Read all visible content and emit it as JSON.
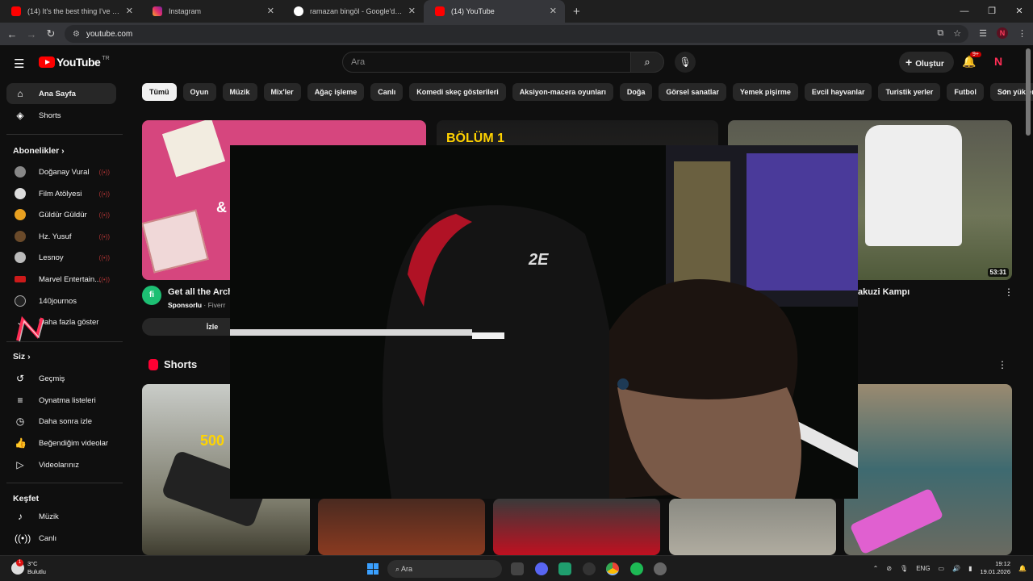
{
  "browser": {
    "tabs": [
      {
        "label": "(14) It's the best thing I've seen",
        "favicon_color": "#ff0000",
        "active": false
      },
      {
        "label": "Instagram",
        "favicon_color": "#e1306c",
        "active": false
      },
      {
        "label": "ramazan bingöl - Google'da Ara",
        "favicon_color": "#ffffff",
        "active": false
      },
      {
        "label": "(14) YouTube",
        "favicon_color": "#ff0000",
        "active": true
      }
    ],
    "url": "youtube.com"
  },
  "header": {
    "logo_text": "YouTube",
    "country_code": "TR",
    "search_placeholder": "Ara",
    "create_label": "Oluştur",
    "notif_badge": "9+"
  },
  "sidebar": {
    "main": [
      {
        "label": "Ana Sayfa",
        "icon": "home-icon"
      },
      {
        "label": "Shorts",
        "icon": "shorts-icon"
      }
    ],
    "subs_heading": "Abonelikler",
    "subscriptions": [
      {
        "label": "Doğanay Vural",
        "color": "#888888"
      },
      {
        "label": "Film Atölyesi",
        "color": "#dddddd"
      },
      {
        "label": "Güldür Güldür",
        "color": "#e8a020"
      },
      {
        "label": "Hz. Yusuf",
        "color": "#6a4a2a"
      },
      {
        "label": "Lesnoy",
        "color": "#bbbbbb"
      },
      {
        "label": "Marvel Entertain...",
        "color": "#cc1a1a"
      },
      {
        "label": "140journos",
        "color": "#222222"
      }
    ],
    "show_more": "Daha fazla göster",
    "you_heading": "Siz",
    "you_items": [
      {
        "label": "Geçmiş",
        "icon": "history-icon"
      },
      {
        "label": "Oynatma listeleri",
        "icon": "playlist-icon"
      },
      {
        "label": "Daha sonra izle",
        "icon": "clock-icon"
      },
      {
        "label": "Beğendiğim videolar",
        "icon": "thumbs-up-icon"
      },
      {
        "label": "Videolarınız",
        "icon": "video-icon"
      }
    ],
    "explore_heading": "Keşfet",
    "explore_items": [
      {
        "label": "Müzik",
        "icon": "music-icon"
      },
      {
        "label": "Canlı",
        "icon": "live-icon"
      }
    ]
  },
  "chips": [
    "Tümü",
    "Oyun",
    "Müzik",
    "Mix'ler",
    "Ağaç işleme",
    "Canlı",
    "Komedi skeç gösterileri",
    "Aksiyon-macera oyunları",
    "Doğa",
    "Görsel sanatlar",
    "Yemek pişirme",
    "Evcil hayvanlar",
    "Turistik yerler",
    "Futbol",
    "Son yüklenen"
  ],
  "videos": {
    "ad_title": "Get all the Archi",
    "ad_sponsor": "Sponsorlu",
    "ad_channel": "Fiverr",
    "ad_button": "İzle",
    "ad_thumb_text": "&",
    "mid_thumb_text": "BÖLÜM 1",
    "right_title": "akuzi Kampı",
    "right_duration": "53:31"
  },
  "shorts": {
    "heading": "Shorts",
    "first_thumb_text": "500"
  },
  "taskbar": {
    "temp": "3°C",
    "weather": "Bulutlu",
    "search": "Ara",
    "lang": "ENG",
    "time": "19:12",
    "date": "19.01.2026"
  }
}
